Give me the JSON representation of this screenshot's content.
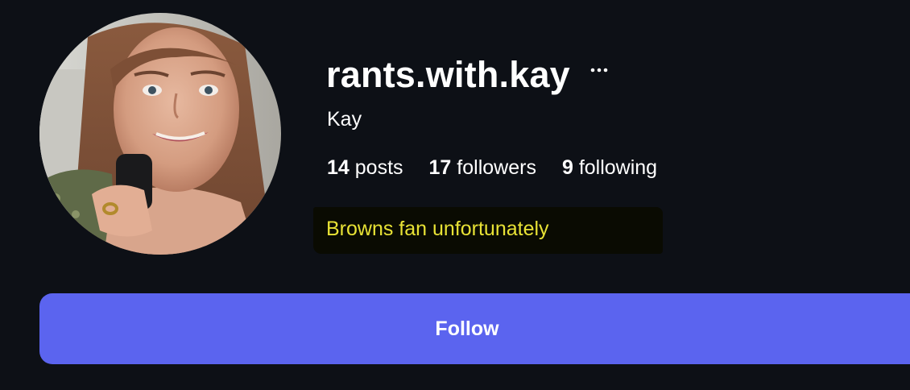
{
  "profile": {
    "username": "rants.with.kay",
    "display_name": "Kay",
    "bio": "Browns fan unfortunately",
    "avatar_icon": "profile-photo",
    "more_icon": "ellipsis-icon"
  },
  "stats": {
    "posts": {
      "count": "14",
      "label": "posts"
    },
    "followers": {
      "count": "17",
      "label": "followers"
    },
    "following": {
      "count": "9",
      "label": "following"
    }
  },
  "actions": {
    "follow_label": "Follow"
  },
  "colors": {
    "background": "#0d1016",
    "accent": "#5b64ef",
    "bio_text": "#e8e235",
    "text": "#ffffff"
  }
}
